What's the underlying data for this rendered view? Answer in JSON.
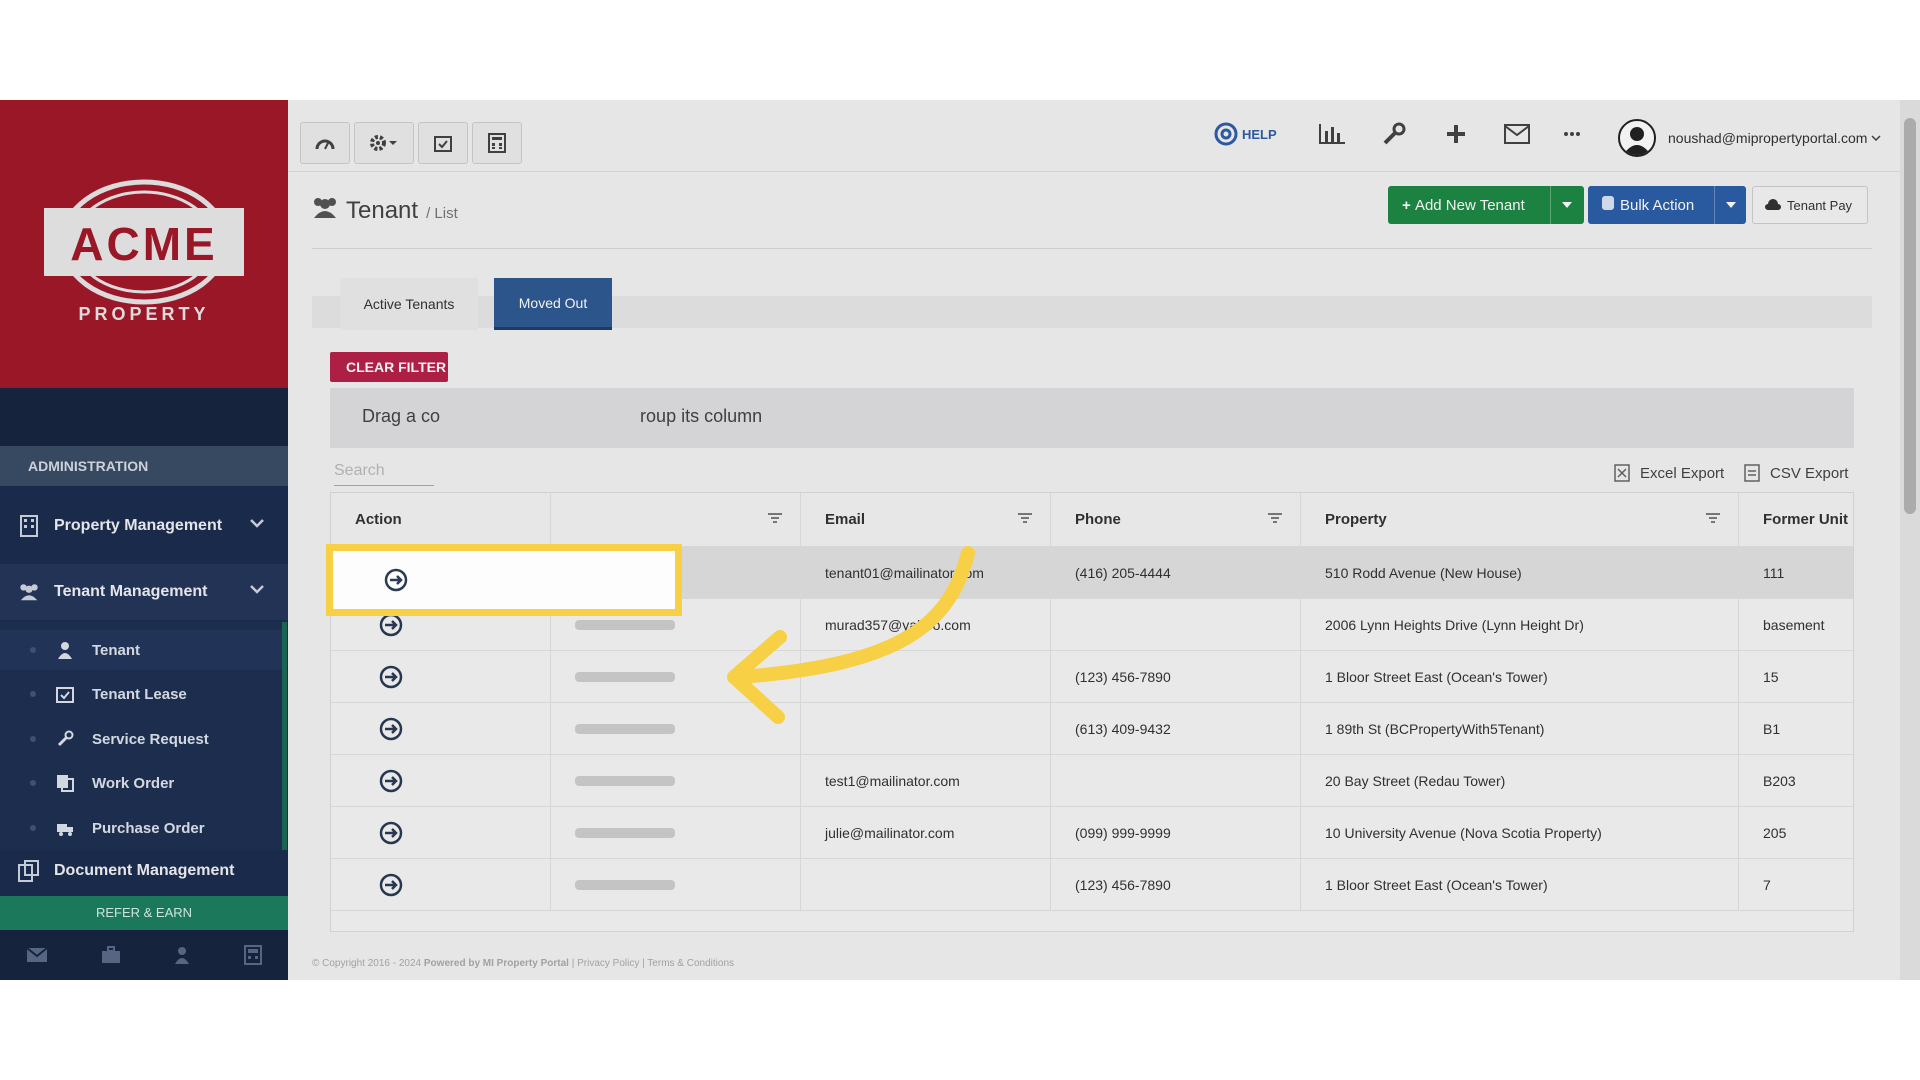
{
  "brand": {
    "name": "ACME",
    "tagline": "PROPERTY",
    "colors": {
      "brand_red": "#a3192b",
      "sidebar": "#1c2d4e",
      "accent_green": "#1e8a45",
      "accent_blue": "#2c5ea7",
      "highlight": "#f7d046"
    }
  },
  "sidebar": {
    "admin_header": "ADMINISTRATION",
    "property_management": "Property Management",
    "tenant_management": "Tenant Management",
    "sub_items": [
      {
        "label": "Tenant",
        "icon": "user-icon"
      },
      {
        "label": "Tenant Lease",
        "icon": "calendar-check-icon"
      },
      {
        "label": "Service Request",
        "icon": "wrench-icon"
      },
      {
        "label": "Work Order",
        "icon": "copy-icon"
      },
      {
        "label": "Purchase Order",
        "icon": "truck-icon"
      }
    ],
    "document_management": "Document Management",
    "refer": "REFER & EARN"
  },
  "topbar": {
    "help": "HELP",
    "user_email": "noushad@mipropertyportal.com"
  },
  "page": {
    "title": "Tenant",
    "crumb": "/ List",
    "add_tenant": "Add New Tenant",
    "bulk_action": "Bulk Action",
    "tenant_pay": "Tenant Pay"
  },
  "tabs": {
    "active": "Active Tenants",
    "moved": "Moved Out"
  },
  "toolbar": {
    "clear_filter": "CLEAR FILTER",
    "group_hint_pre": "Drag a co",
    "group_hint_post": "roup its column",
    "search_placeholder": "Search",
    "excel": "Excel Export",
    "csv": "CSV Export"
  },
  "grid": {
    "headers": {
      "action": "Action",
      "email": "Email",
      "phone": "Phone",
      "property": "Property",
      "former_unit": "Former Unit"
    },
    "rows": [
      {
        "email": "tenant01@mailinator.com",
        "phone": "(416) 205-4444",
        "property": "510 Rodd Avenue (New House)",
        "unit": "111"
      },
      {
        "email": "murad357@yahoo.com",
        "phone": "",
        "property": "2006 Lynn Heights Drive (Lynn Height Dr)",
        "unit": "basement"
      },
      {
        "email": "",
        "phone": "(123) 456-7890",
        "property": "1 Bloor Street East (Ocean's Tower)",
        "unit": "15"
      },
      {
        "email": "",
        "phone": "(613) 409-9432",
        "property": "1 89th St (BCPropertyWith5Tenant)",
        "unit": "B1"
      },
      {
        "email": "test1@mailinator.com",
        "phone": "",
        "property": "20 Bay Street (Redau Tower)",
        "unit": "B203"
      },
      {
        "email": "julie@mailinator.com",
        "phone": "(099) 999-9999",
        "property": "10 University Avenue (Nova Scotia Property)",
        "unit": "205"
      },
      {
        "email": "",
        "phone": "(123) 456-7890",
        "property": "1 Bloor Street East (Ocean's Tower)",
        "unit": "7"
      }
    ]
  },
  "footer": {
    "copyright": "© Copyright 2016 - 2024",
    "powered": "Powered by MI Property Portal",
    "links": "| Privacy Policy | Terms & Conditions"
  }
}
